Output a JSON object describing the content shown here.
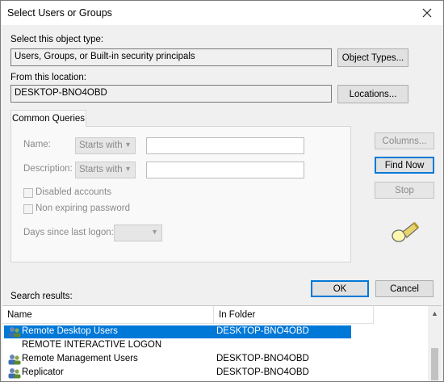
{
  "window": {
    "title": "Select Users or Groups"
  },
  "object_type": {
    "label": "Select this object type:",
    "value": "Users, Groups, or Built-in security principals",
    "button": "Object Types..."
  },
  "location": {
    "label": "From this location:",
    "value": "DESKTOP-BNO4OBD",
    "button": "Locations..."
  },
  "queries": {
    "tab": "Common Queries",
    "name_label": "Name:",
    "name_mode": "Starts with",
    "description_label": "Description:",
    "description_mode": "Starts with",
    "disabled_accounts": "Disabled accounts",
    "non_expiring": "Non expiring password",
    "days_label": "Days since last logon:"
  },
  "side_buttons": {
    "columns": "Columns...",
    "find_now": "Find Now",
    "stop": "Stop"
  },
  "dialog_buttons": {
    "ok": "OK",
    "cancel": "Cancel"
  },
  "results": {
    "label": "Search results:",
    "columns": [
      "Name",
      "In Folder"
    ],
    "rows": [
      {
        "name": "Remote Desktop Users",
        "folder": "DESKTOP-BNO4OBD",
        "selected": true,
        "icon": "group-icon"
      },
      {
        "name": "REMOTE INTERACTIVE LOGON",
        "folder": "",
        "selected": false,
        "icon": "none"
      },
      {
        "name": "Remote Management Users",
        "folder": "DESKTOP-BNO4OBD",
        "selected": false,
        "icon": "group-icon"
      },
      {
        "name": "Replicator",
        "folder": "DESKTOP-BNO4OBD",
        "selected": false,
        "icon": "group-icon"
      }
    ]
  },
  "colors": {
    "selection": "#0078d7",
    "default_button_border": "#0078d7"
  }
}
